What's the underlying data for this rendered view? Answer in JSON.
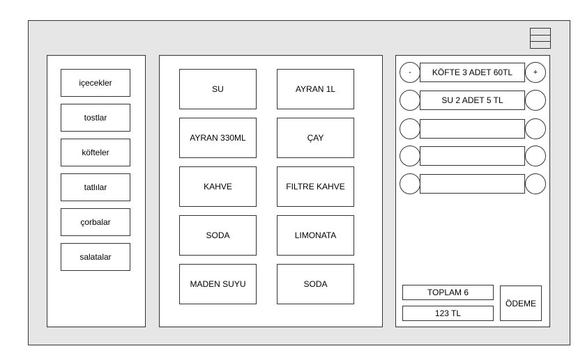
{
  "menu": {
    "icon": "hamburger-menu-icon"
  },
  "categories": [
    "içecekler",
    "tostlar",
    "köfteler",
    "tatlılar",
    "çorbalar",
    "salatalar"
  ],
  "products": [
    "SU",
    "AYRAN 1L",
    "AYRAN 330ML",
    "ÇAY",
    "KAHVE",
    "FILTRE KAHVE",
    "SODA",
    "LIMONATA",
    "MADEN SUYU",
    "SODA"
  ],
  "order": {
    "minus_label": "-",
    "plus_label": "+",
    "items": [
      "KÖFTE 3 ADET 60TL",
      "SU 2 ADET 5 TL",
      "",
      "",
      ""
    ]
  },
  "summary": {
    "total_label": "TOPLAM 6",
    "amount_label": "123 TL",
    "pay_label": "ÖDEME"
  }
}
